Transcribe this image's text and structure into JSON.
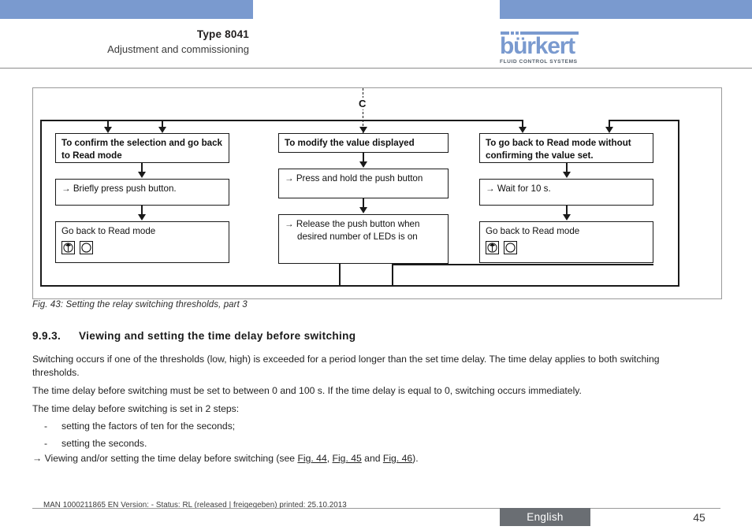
{
  "header": {
    "type_title": "Type 8041",
    "subtitle": "Adjustment and commissioning",
    "logo_word": "bürkert",
    "logo_tagline": "FLUID CONTROL SYSTEMS",
    "accent_color": "#7a9acf"
  },
  "figure": {
    "entry_label": "C",
    "caption": "Fig. 43:  Setting the relay switching thresholds, part 3",
    "columns": [
      {
        "heading": "To confirm the selection and go back to Read mode",
        "steps": [
          "→ Briefly press push button."
        ],
        "result": {
          "text": "Go back to Read mode",
          "leds": [
            "led-on",
            "led-off"
          ]
        }
      },
      {
        "heading": "To modify the value displayed",
        "steps": [
          "→ Press and hold the push button",
          "→ Release the push button when desired number of LEDs is on"
        ],
        "result": null
      },
      {
        "heading": "To go back to Read mode without confirming the value set.",
        "steps": [
          "→ Wait for 10 s."
        ],
        "result": {
          "text": "Go back to Read mode",
          "leds": [
            "led-on",
            "led-off"
          ]
        }
      }
    ]
  },
  "section": {
    "number": "9.9.3.",
    "title": "Viewing and setting the time delay before switching",
    "paragraph_1": "Switching occurs if one of the thresholds (low, high) is exceeded for a period longer than the set time delay. The time delay applies to both switching thresholds.",
    "paragraph_2": "The time delay before switching must be set to between 0 and 100 s. If the time delay is equal to 0, switching occurs immediately.",
    "paragraph_3": "The time delay before switching is set in 2 steps:",
    "bullets": [
      "setting the factors of ten for the seconds;",
      "setting the seconds."
    ],
    "bullet_marker": "-",
    "final_line_prefix": "→ Viewing and/or setting the time delay before switching (see ",
    "final_links": [
      "Fig. 44",
      "Fig. 45",
      "Fig. 46"
    ],
    "final_sep_1": ", ",
    "final_sep_2": " and ",
    "final_line_suffix": ")."
  },
  "footer": {
    "doc_note": "MAN 1000211865 EN Version: - Status: RL (released | freigegeben) printed: 25.10.2013",
    "language": "English",
    "page_number": "45",
    "language_box_color": "#6a6e73"
  }
}
